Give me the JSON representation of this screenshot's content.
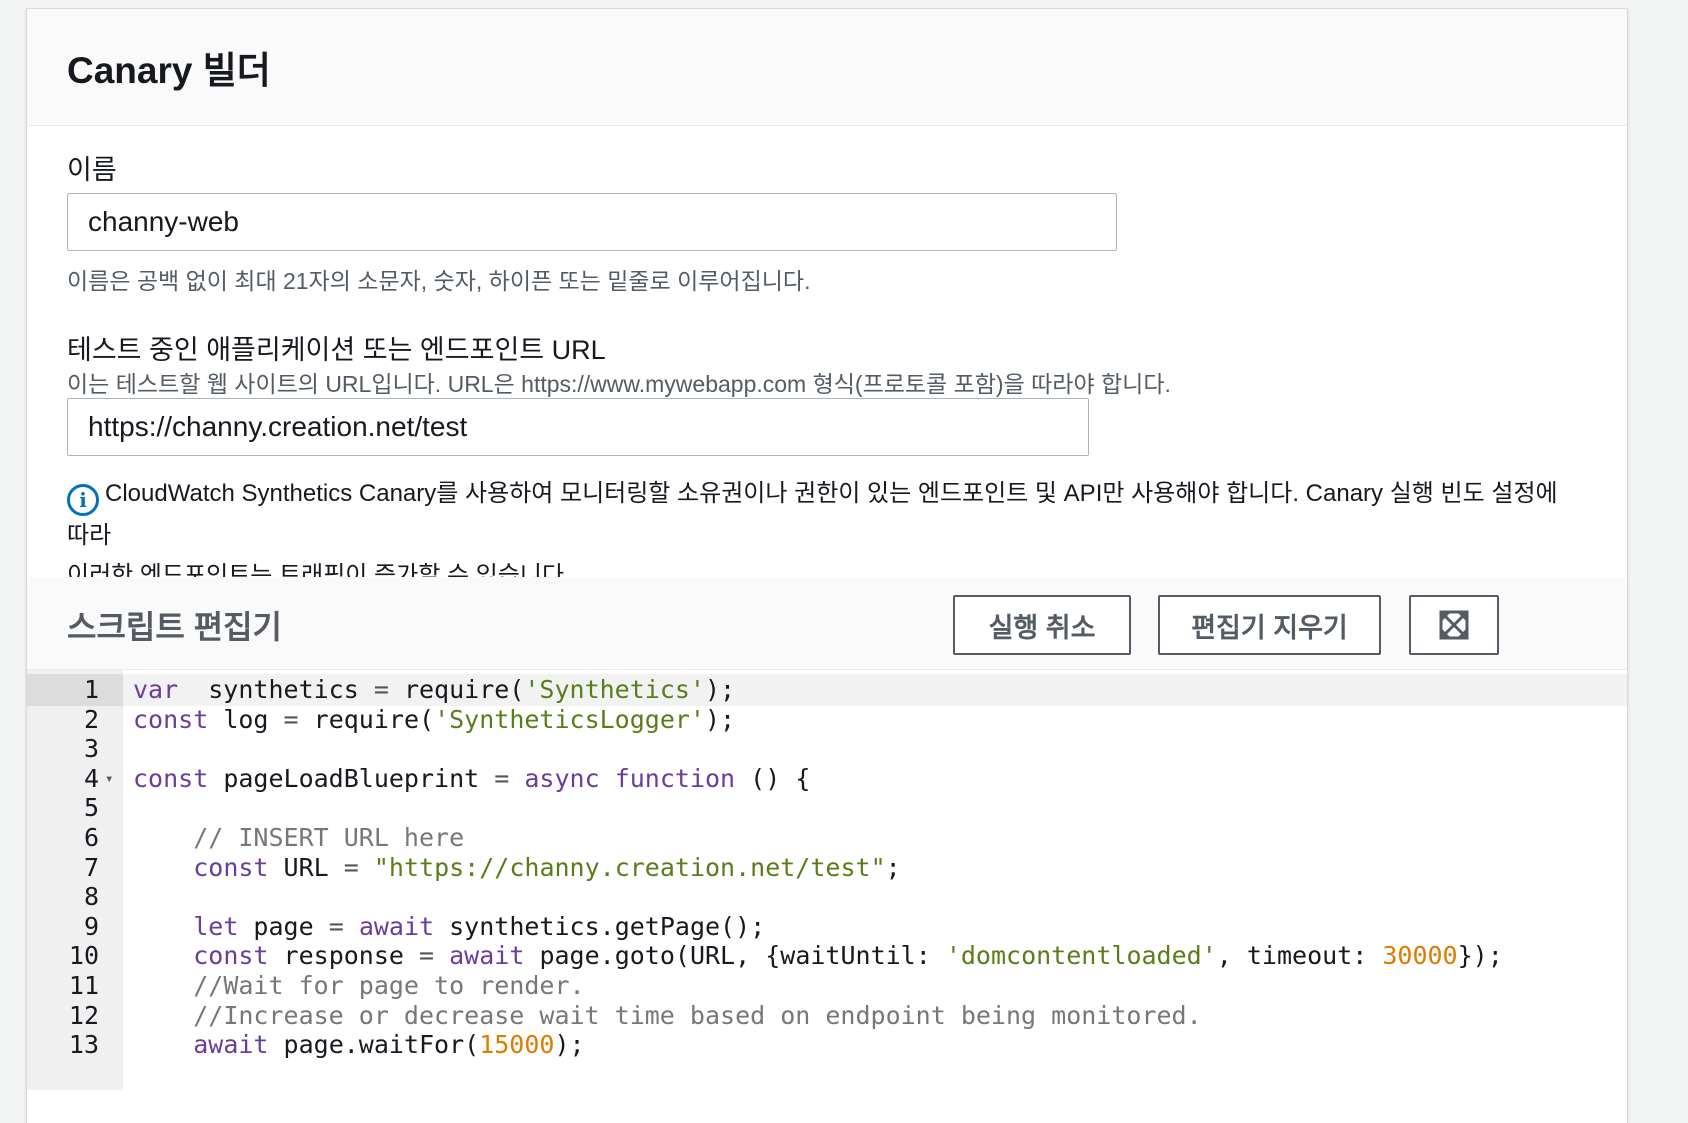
{
  "panel": {
    "title": "Canary 빌더"
  },
  "name_field": {
    "label": "이름",
    "value": "channy-web",
    "description": "이름은 공백 없이 최대 21자의 소문자, 숫자, 하이픈 또는 밑줄로 이루어집니다."
  },
  "url_field": {
    "label": "테스트 중인 애플리케이션 또는 엔드포인트 URL",
    "description": "이는 테스트할 웹 사이트의 URL입니다. URL은 https://www.mywebapp.com 형식(프로토콜 포함)을 따라야 합니다.",
    "value": "https://channy.creation.net/test"
  },
  "info": {
    "icon": "info-icon",
    "line1": "CloudWatch Synthetics Canary를 사용하여 모니터링할 소유권이나 권한이 있는 엔드포인트 및 API만 사용해야 합니다. Canary 실행 빈도 설정에 따라",
    "line2": "이러한 엔드포인트는 트래픽이 증가할 수 있습니다."
  },
  "editor": {
    "heading": "스크립트 편집기",
    "cancel_label": "실행 취소",
    "clear_label": "편집기 지우기",
    "fullscreen_icon": "expand-icon"
  },
  "code_lines": [
    {
      "n": "1",
      "active": true,
      "tokens": [
        [
          "kw",
          "var"
        ],
        [
          "",
          "  synthetics "
        ],
        [
          "op",
          "="
        ],
        [
          "",
          " require("
        ],
        [
          "str",
          "'Synthetics'"
        ],
        [
          "",
          ");"
        ]
      ]
    },
    {
      "n": "2",
      "tokens": [
        [
          "kw",
          "const"
        ],
        [
          "",
          " log "
        ],
        [
          "op",
          "="
        ],
        [
          "",
          " require("
        ],
        [
          "str",
          "'SyntheticsLogger'"
        ],
        [
          "",
          ");"
        ]
      ]
    },
    {
      "n": "3",
      "tokens": []
    },
    {
      "n": "4",
      "fold": true,
      "tokens": [
        [
          "kw",
          "const"
        ],
        [
          "",
          " pageLoadBlueprint "
        ],
        [
          "op",
          "="
        ],
        [
          "",
          " "
        ],
        [
          "kw",
          "async"
        ],
        [
          "",
          " "
        ],
        [
          "kw",
          "function"
        ],
        [
          "",
          " () {"
        ]
      ]
    },
    {
      "n": "5",
      "tokens": []
    },
    {
      "n": "6",
      "tokens": [
        [
          "",
          "    "
        ],
        [
          "cm",
          "// INSERT URL here"
        ]
      ]
    },
    {
      "n": "7",
      "tokens": [
        [
          "",
          "    "
        ],
        [
          "kw",
          "const"
        ],
        [
          "",
          " URL "
        ],
        [
          "op",
          "="
        ],
        [
          "",
          " "
        ],
        [
          "str",
          "\"https://channy.creation.net/test\""
        ],
        [
          "",
          ";"
        ]
      ]
    },
    {
      "n": "8",
      "tokens": []
    },
    {
      "n": "9",
      "tokens": [
        [
          "",
          "    "
        ],
        [
          "kw",
          "let"
        ],
        [
          "",
          " page "
        ],
        [
          "op",
          "="
        ],
        [
          "",
          " "
        ],
        [
          "kw",
          "await"
        ],
        [
          "",
          " synthetics.getPage();"
        ]
      ]
    },
    {
      "n": "10",
      "tokens": [
        [
          "",
          "    "
        ],
        [
          "kw",
          "const"
        ],
        [
          "",
          " response "
        ],
        [
          "op",
          "="
        ],
        [
          "",
          " "
        ],
        [
          "kw",
          "await"
        ],
        [
          "",
          " page.goto(URL, {waitUntil: "
        ],
        [
          "str",
          "'domcontentloaded'"
        ],
        [
          "",
          ", timeout: "
        ],
        [
          "num",
          "30000"
        ],
        [
          "",
          "});"
        ]
      ]
    },
    {
      "n": "11",
      "tokens": [
        [
          "",
          "    "
        ],
        [
          "cm",
          "//Wait for page to render."
        ]
      ]
    },
    {
      "n": "12",
      "tokens": [
        [
          "",
          "    "
        ],
        [
          "cm",
          "//Increase or decrease wait time based on endpoint being monitored."
        ]
      ]
    },
    {
      "n": "13",
      "tokens": [
        [
          "",
          "    "
        ],
        [
          "kw",
          "await"
        ],
        [
          "",
          " page.waitFor("
        ],
        [
          "num",
          "15000"
        ],
        [
          "",
          ");"
        ]
      ]
    }
  ]
}
